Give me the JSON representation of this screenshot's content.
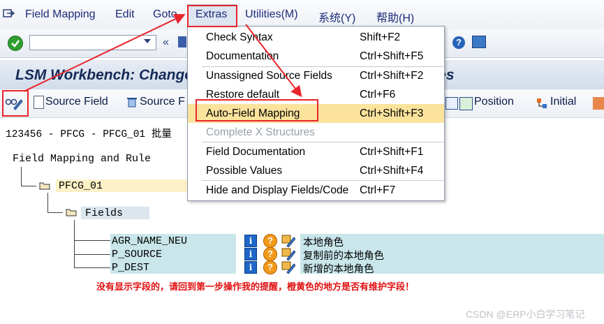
{
  "menubar": {
    "items": [
      {
        "label": "Field Mapping",
        "mnemonic": "F"
      },
      {
        "label": "Edit",
        "mnemonic": "E"
      },
      {
        "label": "Goto",
        "mnemonic": "G"
      },
      {
        "label": "Extras",
        "mnemonic": "x"
      },
      {
        "label": "Utilities(M)",
        "mnemonic": "U"
      },
      {
        "label": "系统(Y)"
      },
      {
        "label": "帮助(H)"
      }
    ]
  },
  "title": "LSM Workbench: Change Field Mapping and Conversion Rules",
  "toolbar2": {
    "source_field": "Source Field",
    "source_field_delete": "Source F",
    "position": "Position",
    "initial": "Initial"
  },
  "breadcrumb": "123456 - PFCG - PFCG_01 批量",
  "tree": {
    "root": "Field Mapping and Rule",
    "object": "PFCG_01",
    "fields_node": "Fields",
    "fields": [
      {
        "name": "AGR_NAME_NEU",
        "description": "本地角色"
      },
      {
        "name": "P_SOURCE",
        "description": "复制前的本地角色"
      },
      {
        "name": "P_DEST",
        "description": "新增的本地角色"
      }
    ]
  },
  "note": "没有显示字段的，请回到第一步操作我的提醒，橙黄色的地方是否有维护字段！",
  "watermark": "CSDN @ERP小白学习笔记",
  "extras_menu": {
    "items": [
      {
        "label": "Check Syntax",
        "shortcut": "Shift+F2",
        "enabled": true
      },
      {
        "label": "Documentation",
        "shortcut": "Ctrl+Shift+F5",
        "enabled": true
      },
      {
        "label": "Unassigned Source Fields",
        "shortcut": "Ctrl+Shift+F2",
        "enabled": true
      },
      {
        "label": "Restore default",
        "shortcut": "Ctrl+F6",
        "enabled": true
      },
      {
        "label": "Auto-Field Mapping",
        "shortcut": "Ctrl+Shift+F3",
        "enabled": true,
        "highlighted": true
      },
      {
        "label": "Complete X Structures",
        "shortcut": "",
        "enabled": false
      },
      {
        "label": "Field Documentation",
        "shortcut": "Ctrl+Shift+F1",
        "enabled": true
      },
      {
        "label": "Possible Values",
        "shortcut": "Ctrl+Shift+F4",
        "enabled": true
      },
      {
        "label": "Hide and Display Fields/Code",
        "shortcut": "Ctrl+F7",
        "enabled": true
      }
    ]
  },
  "colors": {
    "highlight": "#fbe39c",
    "annotation_red": "#e8242b",
    "note_red": "#e01010",
    "title_blue": "#142a57"
  }
}
